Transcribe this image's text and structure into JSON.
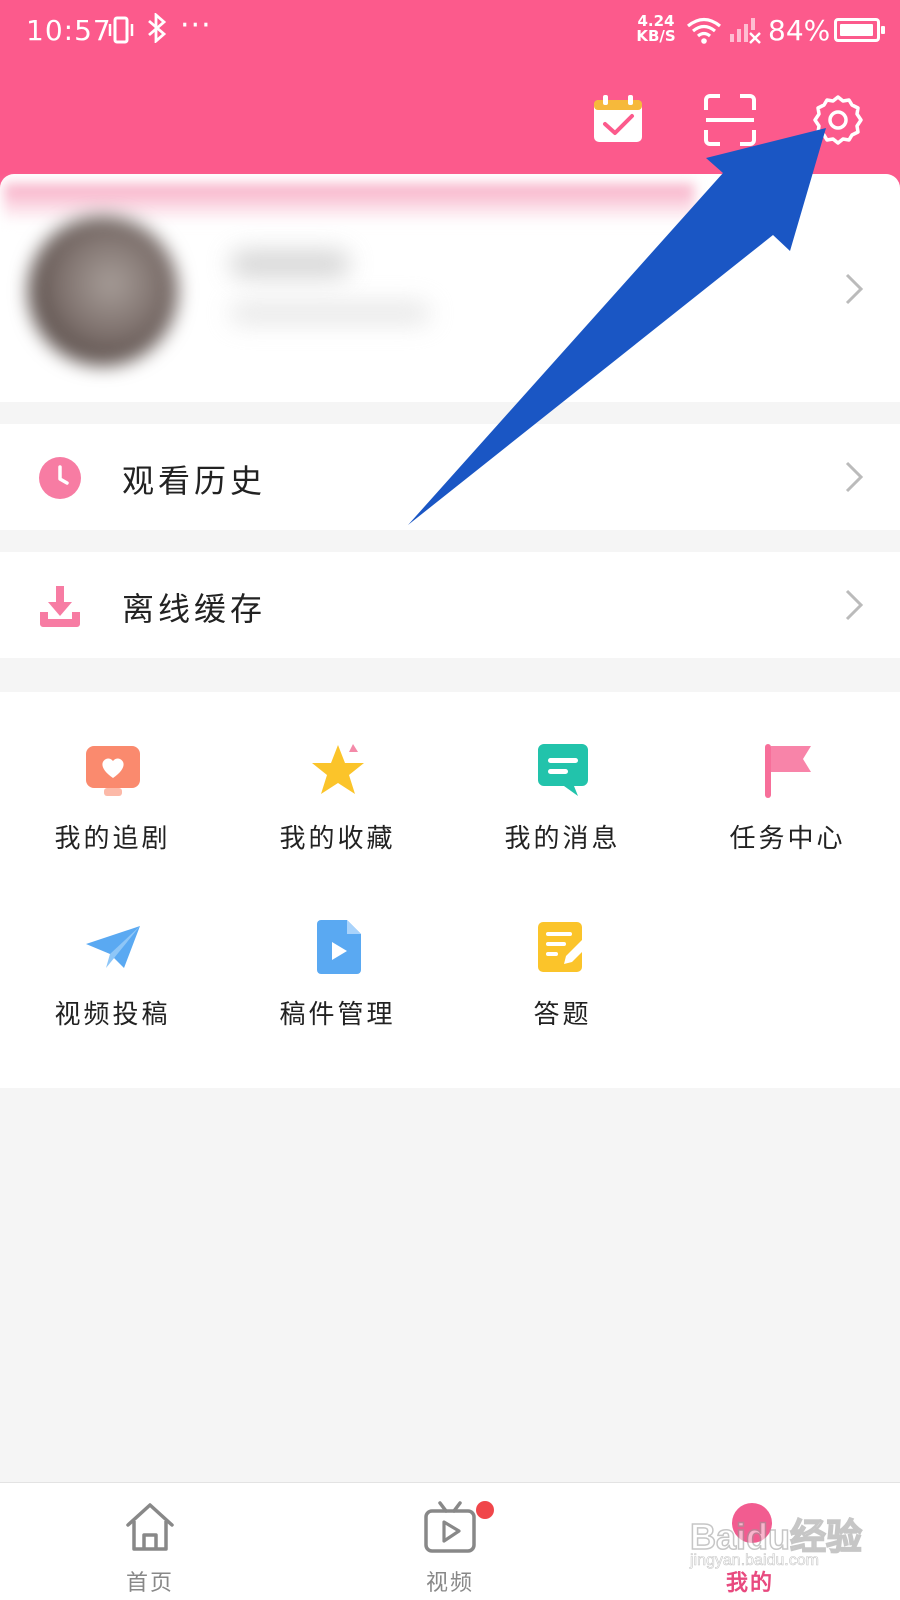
{
  "status_bar": {
    "time": "10:57",
    "more": "···",
    "net_speed_value": "4.24",
    "net_speed_unit": "KB/S",
    "battery": "84%"
  },
  "header": {
    "icons": [
      "calendar-check-icon",
      "scan-icon",
      "settings-gear-icon"
    ]
  },
  "menu": {
    "history_label": "观看历史",
    "offline_label": "离线缓存"
  },
  "grid": {
    "items": [
      {
        "label": "我的追剧",
        "icon": "heart-tv-icon",
        "color": "#fa8a6e"
      },
      {
        "label": "我的收藏",
        "icon": "star-icon",
        "color": "#fbc42a"
      },
      {
        "label": "我的消息",
        "icon": "message-icon",
        "color": "#22c3ab"
      },
      {
        "label": "任务中心",
        "icon": "flag-icon",
        "color": "#f76f9a"
      },
      {
        "label": "视频投稿",
        "icon": "paper-plane-icon",
        "color": "#5aa9f2"
      },
      {
        "label": "稿件管理",
        "icon": "video-file-icon",
        "color": "#5aa9f2"
      },
      {
        "label": "答题",
        "icon": "edit-note-icon",
        "color": "#fbc42a"
      }
    ]
  },
  "bottom_nav": {
    "home_label": "首页",
    "video_label": "视频",
    "me_label": "我的"
  },
  "watermark": {
    "main": "Baidu经验",
    "sub": "jingyan.baidu.com"
  },
  "colors": {
    "brand_pink": "#fc5a8c",
    "annotation_arrow": "#1a56c4"
  }
}
